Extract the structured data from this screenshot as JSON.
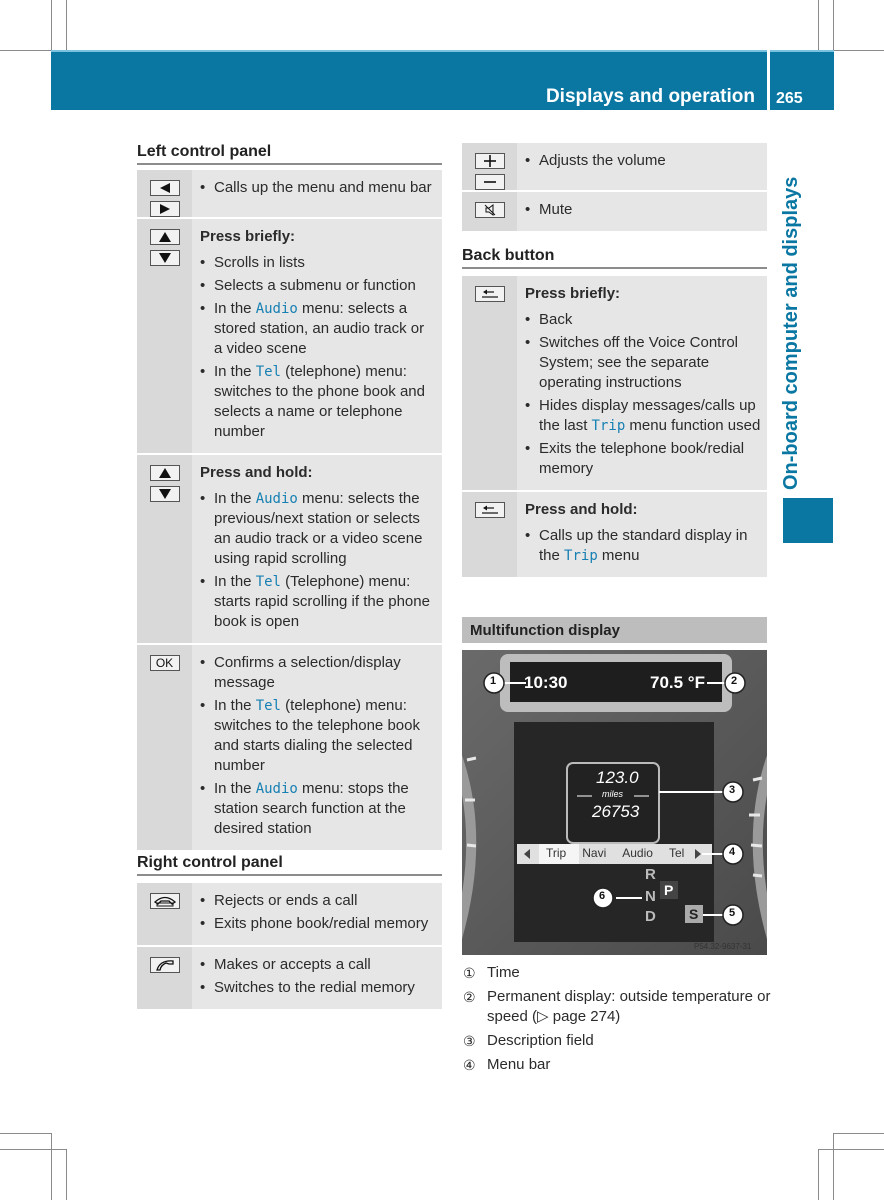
{
  "header": {
    "title": "Displays and operation",
    "page_number": "265"
  },
  "side_tab": {
    "label": "On-board computer and displays"
  },
  "left_panel": {
    "title": "Left control panel",
    "rows": [
      {
        "keys": [
          "left-arrow",
          "right-arrow"
        ],
        "heading": "",
        "items": [
          {
            "parts": [
              {
                "t": "Calls up the menu and menu bar"
              }
            ]
          }
        ]
      },
      {
        "keys": [
          "up-arrow",
          "down-arrow"
        ],
        "heading": "Press briefly:",
        "items": [
          {
            "parts": [
              {
                "t": "Scrolls in lists"
              }
            ]
          },
          {
            "parts": [
              {
                "t": "Selects a submenu or function"
              }
            ]
          },
          {
            "parts": [
              {
                "t": "In the "
              },
              {
                "m": "Audio"
              },
              {
                "t": " menu: selects a stored station, an audio track or a video scene"
              }
            ]
          },
          {
            "parts": [
              {
                "t": "In the "
              },
              {
                "m": "Tel"
              },
              {
                "t": " (telephone) menu: switches to the phone book and selects a name or telephone number"
              }
            ]
          }
        ]
      },
      {
        "keys": [
          "up-arrow",
          "down-arrow"
        ],
        "heading": "Press and hold:",
        "items": [
          {
            "parts": [
              {
                "t": "In the "
              },
              {
                "m": "Audio"
              },
              {
                "t": " menu: selects the previous/next station or selects an audio track or a video scene using rapid scrolling"
              }
            ]
          },
          {
            "parts": [
              {
                "t": "In the "
              },
              {
                "m": "Tel"
              },
              {
                "t": " (Telephone) menu: starts rapid scrolling if the phone book is open"
              }
            ]
          }
        ]
      },
      {
        "keys": [
          "ok"
        ],
        "heading": "",
        "items": [
          {
            "parts": [
              {
                "t": "Confirms a selection/display message"
              }
            ]
          },
          {
            "parts": [
              {
                "t": "In the "
              },
              {
                "m": "Tel"
              },
              {
                "t": " (telephone) menu: switches to the telephone book and starts dialing the selected number"
              }
            ]
          },
          {
            "parts": [
              {
                "t": "In the "
              },
              {
                "m": "Audio"
              },
              {
                "t": " menu: stops the station search function at the desired station"
              }
            ]
          }
        ]
      }
    ]
  },
  "right_panel": {
    "title": "Right control panel",
    "rows": [
      {
        "keys": [
          "hang-up"
        ],
        "heading": "",
        "items": [
          {
            "parts": [
              {
                "t": "Rejects or ends a call"
              }
            ]
          },
          {
            "parts": [
              {
                "t": "Exits phone book/redial memory"
              }
            ]
          }
        ]
      },
      {
        "keys": [
          "pick-up"
        ],
        "heading": "",
        "items": [
          {
            "parts": [
              {
                "t": "Makes or accepts a call"
              }
            ]
          },
          {
            "parts": [
              {
                "t": "Switches to the redial memory"
              }
            ]
          }
        ]
      }
    ]
  },
  "volume_panel": {
    "rows": [
      {
        "keys": [
          "plus",
          "minus"
        ],
        "heading": "",
        "items": [
          {
            "parts": [
              {
                "t": "Adjusts the volume"
              }
            ]
          }
        ]
      },
      {
        "keys": [
          "mute"
        ],
        "heading": "",
        "items": [
          {
            "parts": [
              {
                "t": "Mute"
              }
            ]
          }
        ]
      }
    ]
  },
  "back_button": {
    "title": "Back button",
    "rows": [
      {
        "keys": [
          "back"
        ],
        "heading": "Press briefly:",
        "items": [
          {
            "parts": [
              {
                "t": "Back"
              }
            ]
          },
          {
            "parts": [
              {
                "t": "Switches off the Voice Control System; see the separate operating instructions"
              }
            ]
          },
          {
            "parts": [
              {
                "t": "Hides display messages/calls up the last "
              },
              {
                "m": "Trip"
              },
              {
                "t": " menu function used"
              }
            ]
          },
          {
            "parts": [
              {
                "t": "Exits the telephone book/redial memory"
              }
            ]
          }
        ]
      },
      {
        "keys": [
          "back"
        ],
        "heading": "Press and hold:",
        "items": [
          {
            "parts": [
              {
                "t": "Calls up the standard display in the "
              },
              {
                "m": "Trip"
              },
              {
                "t": " menu"
              }
            ]
          }
        ]
      }
    ]
  },
  "multifunction": {
    "title": "Multifunction display",
    "display": {
      "time": "10:30",
      "temperature": "70.5 °F",
      "trip_value": "123.0",
      "trip_unit": "miles",
      "odometer": "26753",
      "menu_items": [
        "Trip",
        "Navi",
        "Audio",
        "Tel"
      ],
      "selected_menu": "Trip",
      "gears": [
        "R",
        "N",
        "D"
      ],
      "gear_selected": "P",
      "mode_badge": "S",
      "callouts": [
        "1",
        "2",
        "3",
        "4",
        "5",
        "6"
      ],
      "image_ref": "P54.32-9637-31"
    },
    "legend": [
      {
        "num": "①",
        "text": "Time"
      },
      {
        "num": "②",
        "text": "Permanent display: outside temperature or speed (▷ page 274)"
      },
      {
        "num": "③",
        "text": "Description field"
      },
      {
        "num": "④",
        "text": "Menu bar"
      }
    ]
  },
  "colors": {
    "brand": "#0a77a3",
    "highlight_mono": "#1780b3",
    "row_bg": "#e6e6e6",
    "key_col_bg": "#d9d9d9"
  }
}
